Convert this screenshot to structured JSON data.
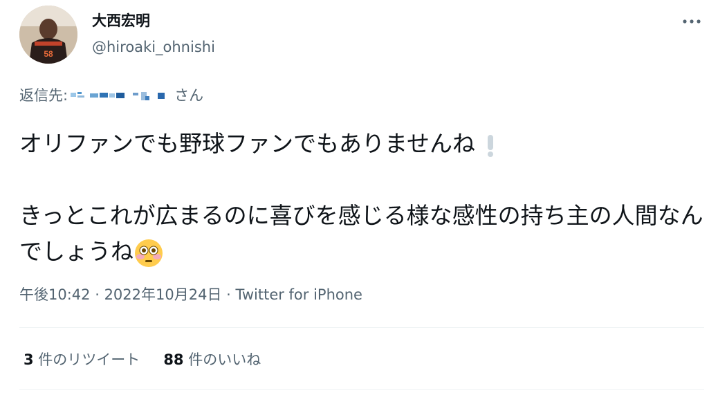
{
  "author": {
    "display_name": "大西宏明",
    "handle": "@hiroaki_ohnishi",
    "avatar_jersey_number": "58"
  },
  "more_icon": "ellipsis-icon",
  "reply": {
    "prefix": "返信先:",
    "suffix": "さん"
  },
  "tweet": {
    "line1": "オリファンでも野球ファンでもありませんね",
    "emoji1": "exclamation-icon",
    "line2": "きっとこれが広まるのに喜びを感じる様な感性の持ち主の人間なんでしょうね",
    "emoji2": "flushed-face-icon"
  },
  "meta": {
    "time": "午後10:42",
    "date": "2022年10月24日",
    "sep": " · ",
    "source": "Twitter for iPhone"
  },
  "stats": {
    "retweets_count": "3",
    "retweets_label": " 件のリツイート",
    "likes_count": "88",
    "likes_label": " 件のいいね"
  },
  "colors": {
    "text": "#0f1419",
    "secondary": "#536471",
    "divider": "#eff3f4"
  }
}
